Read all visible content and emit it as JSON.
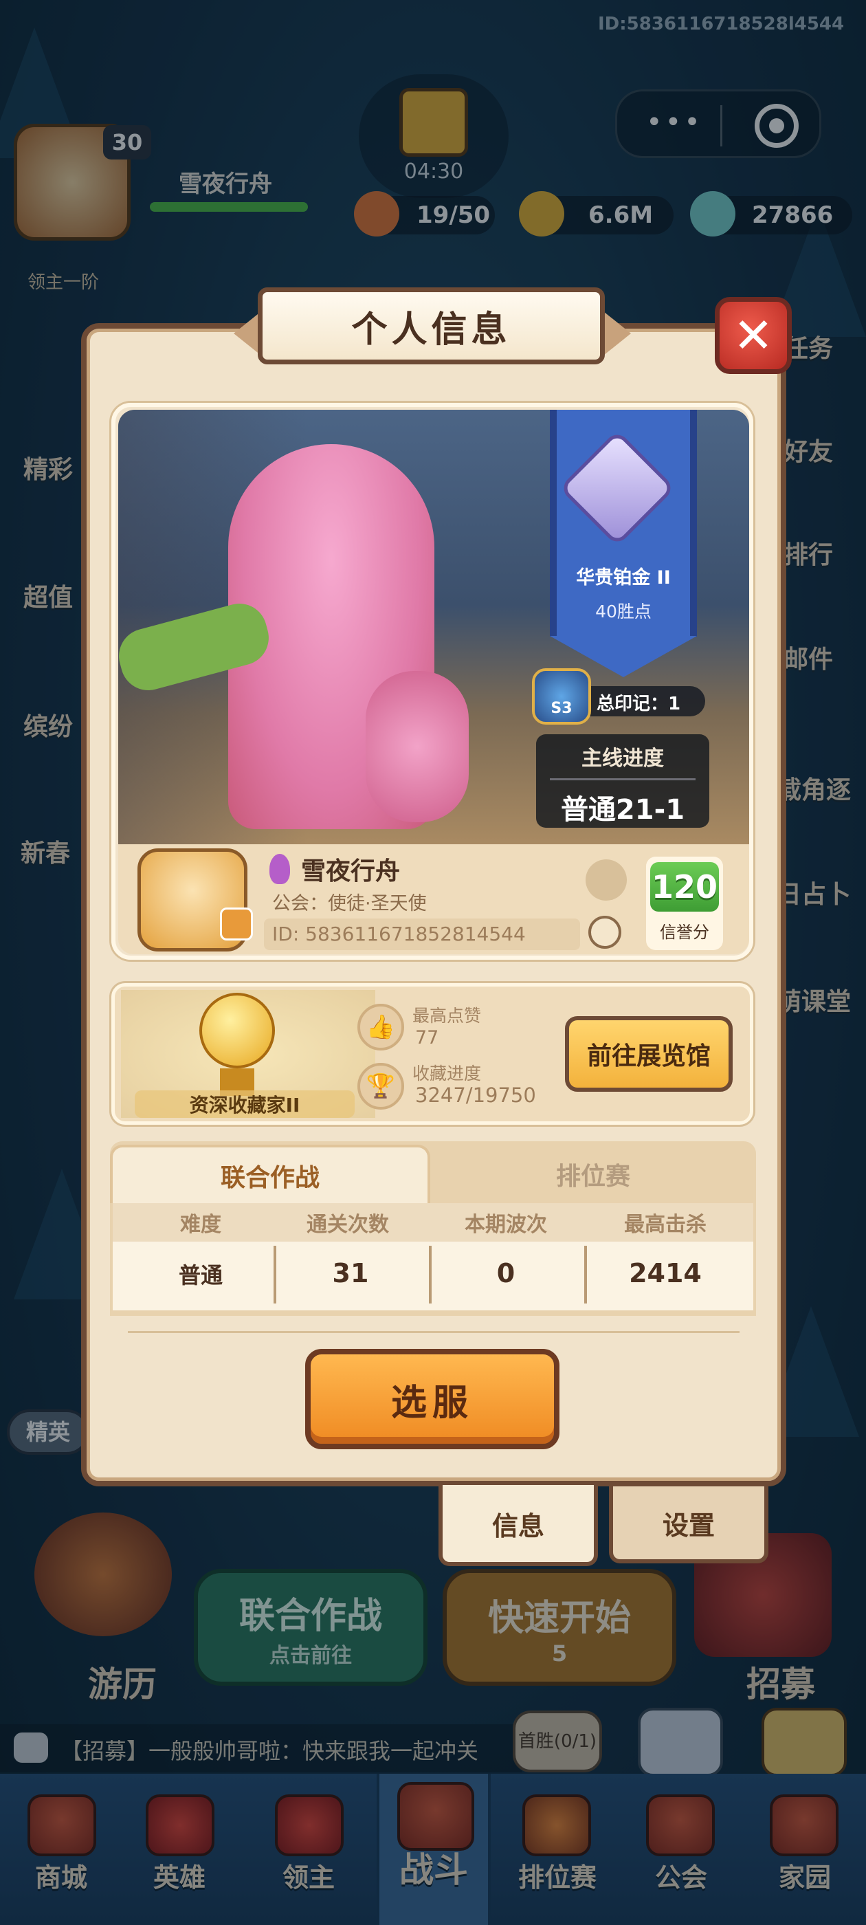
{
  "colors": {
    "accent": "#f0902a",
    "modal_bg": "#f1e3cb",
    "credit_green": "#4caf3f",
    "close_red": "#d83a2e",
    "banner_blue": "#3e69c4"
  },
  "hud": {
    "top_id": "ID:5836116718528l4544",
    "timer": "04:30",
    "level": "30",
    "player_name": "雪夜行舟",
    "rank_label": "领主一阶",
    "stamina": "19/50",
    "gold": "6.6M",
    "gems": "27866",
    "menu_dots": "•••"
  },
  "side_left": [
    "精彩",
    "超值",
    "缤纷",
    "新春",
    "精英"
  ],
  "side_right": [
    "任务",
    "好友",
    "排行",
    "邮件",
    "载角逐",
    "日占卜",
    "萌课堂"
  ],
  "modal": {
    "title": "个人信息",
    "close_glyph": "✕",
    "rank_name": "华贵铂金 II",
    "rank_points": "40胜点",
    "season_badge": "S3",
    "total_marks": "总印记：1",
    "progress_label": "主线进度",
    "progress_value": "普通21-1",
    "name": "雪夜行舟",
    "guild": "公会：使徒·圣天使",
    "id": "ID: 583611671852814544",
    "credit_value": "120",
    "credit_label": "信誉分",
    "collector_title": "资深收藏家II",
    "likes_label": "最高点赞",
    "likes_value": "77",
    "collect_label": "收藏进度",
    "collect_value": "3247/19750",
    "gallery_button": "前往展览馆",
    "tab_active": "联合作战",
    "tab_inactive": "排位赛",
    "table": {
      "headers": [
        "难度",
        "通关次数",
        "本期波次",
        "最高击杀"
      ],
      "row": [
        "普通",
        "31",
        "0",
        "2414"
      ]
    },
    "select_button": "选服",
    "bottom_tab_info": "信息",
    "bottom_tab_settings": "设置"
  },
  "behind": {
    "coop_title": "联合作战",
    "coop_sub": "点击前往",
    "quick_title": "快速开始",
    "quick_cost": "5",
    "travel": "游历",
    "recruit": "招募",
    "first_win": "首胜(0/1)",
    "chat": "【招募】一般般帅哥啦：快来跟我一起冲关"
  },
  "nav": [
    "商城",
    "英雄",
    "领主",
    "战斗",
    "排位赛",
    "公会",
    "家园"
  ]
}
